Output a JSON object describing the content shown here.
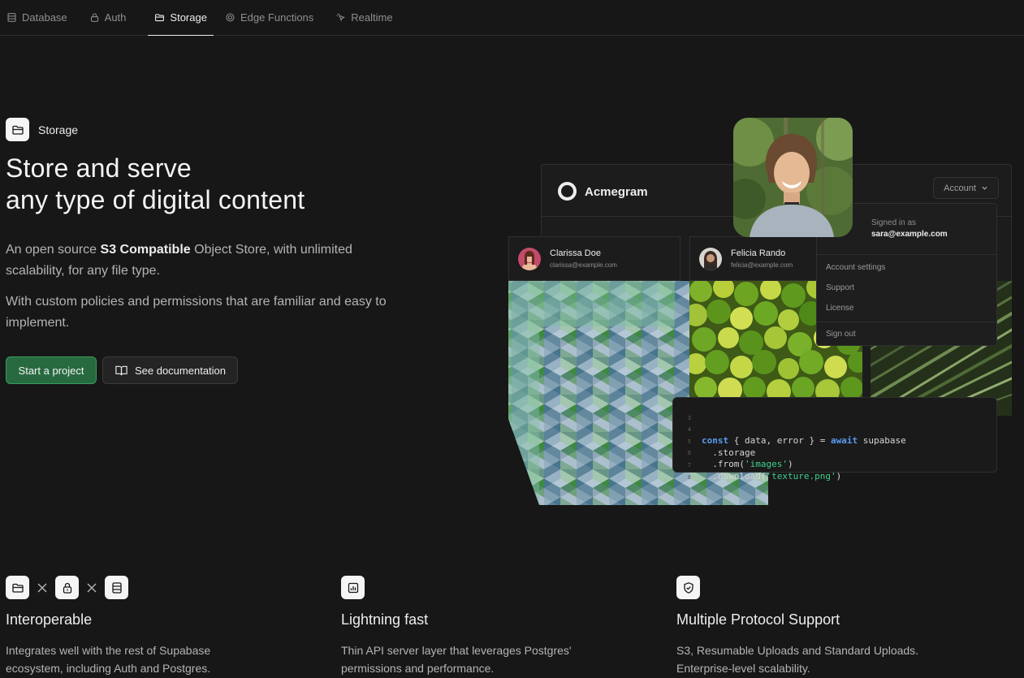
{
  "nav": {
    "tabs": [
      {
        "label": "Database",
        "icon": "database-icon"
      },
      {
        "label": "Auth",
        "icon": "lock-icon"
      },
      {
        "label": "Storage",
        "icon": "folder-icon",
        "active": true
      },
      {
        "label": "Edge Functions",
        "icon": "edge-functions-icon"
      },
      {
        "label": "Realtime",
        "icon": "realtime-icon"
      }
    ]
  },
  "hero": {
    "badge_label": "Storage",
    "title_line1": "Store and serve",
    "title_line2": "any type of digital content",
    "p1_pre": "An open source ",
    "p1_bold": "S3 Compatible",
    "p1_post": " Object Store, with unlimited scalability, for any file type.",
    "p2": "With custom policies and permissions that are familiar and easy to implement.",
    "primary_button": "Start a project",
    "secondary_button": "See documentation"
  },
  "mockup": {
    "app_name": "Acmegram",
    "account_button": "Account",
    "dropdown": {
      "signed_in_label": "Signed in as",
      "email": "sara@example.com",
      "items": [
        "Account settings",
        "Support",
        "License",
        "Sign out"
      ]
    },
    "users": [
      {
        "name": "Clarissa Doe",
        "email": "clarissa@example.com"
      },
      {
        "name": "Felicia Rando",
        "email": "felicia@example.com"
      }
    ],
    "code": {
      "line_numbers": [
        "3",
        "4",
        "5",
        "6",
        "7",
        "8"
      ],
      "kw_const": "const",
      "l4_mid": " { data, error } = ",
      "kw_await": "await",
      "l4_end": " supabase",
      "l5": "  .storage",
      "l6_pre": "  .from(",
      "l6_str": "'images'",
      "l6_post": ")",
      "l7_pre": "  .download(",
      "l7_str": "'texture.png'",
      "l7_post": ")"
    }
  },
  "features": [
    {
      "title": "Interoperable",
      "description": "Integrates well with the rest of Supabase ecosystem, including Auth and Postgres."
    },
    {
      "title": "Lightning fast",
      "description": "Thin API server layer that leverages Postgres' permissions and performance."
    },
    {
      "title": "Multiple Protocol Support",
      "description": "S3, Resumable Uploads and Standard Uploads. Enterprise-level scalability."
    }
  ],
  "colors": {
    "background": "#171717",
    "brand_green": "#3ecf8e",
    "primary_button": "#276a3f"
  }
}
